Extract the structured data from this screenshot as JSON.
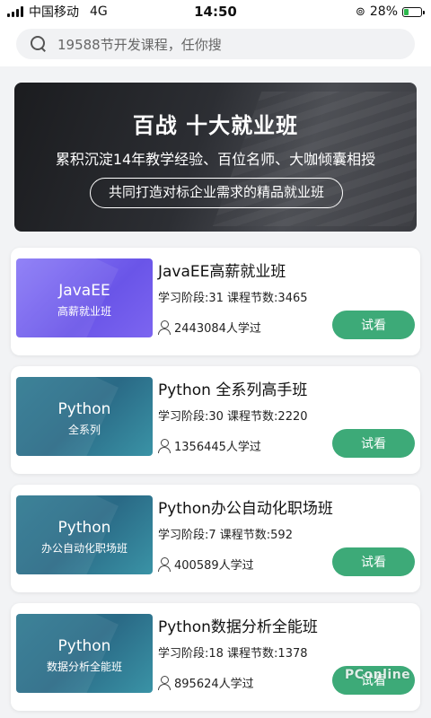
{
  "status_bar": {
    "carrier": "中国移动",
    "network": "4G",
    "time": "14:50",
    "battery": "28%",
    "battery_level": 0.28,
    "battery_color": "#2db84d"
  },
  "search": {
    "placeholder": "19588节开发课程，任你搜"
  },
  "banner": {
    "title": "百战 十大就业班",
    "subtitle": "累积沉淀14年教学经验、百位名师、大咖倾囊相授",
    "tag": "共同打造对标企业需求的精品就业班"
  },
  "courses": [
    {
      "thumb_title": "JavaEE",
      "thumb_sub": "高薪就业班",
      "thumb_style": "purple",
      "title": "JavaEE高薪就业班",
      "meta": "学习阶段:31 课程节数:3465",
      "learners": "2443084人学过",
      "button": "试看"
    },
    {
      "thumb_title": "Python",
      "thumb_sub": "全系列",
      "thumb_style": "teal",
      "title": "Python 全系列高手班",
      "meta": "学习阶段:30 课程节数:2220",
      "learners": "1356445人学过",
      "button": "试看"
    },
    {
      "thumb_title": "Python",
      "thumb_sub": "办公自动化职场班",
      "thumb_style": "teal",
      "title": "Python办公自动化职场班",
      "meta": "学习阶段:7 课程节数:592",
      "learners": "400589人学过",
      "button": "试看"
    },
    {
      "thumb_title": "Python",
      "thumb_sub": "数据分析全能班",
      "thumb_style": "teal",
      "title": "Python数据分析全能班",
      "meta": "学习阶段:18 课程节数:1378",
      "learners": "895624人学过",
      "button": "试看"
    }
  ],
  "watermark": "PConline",
  "colors": {
    "accent": "#3daa78",
    "background": "#f2f3f5"
  }
}
